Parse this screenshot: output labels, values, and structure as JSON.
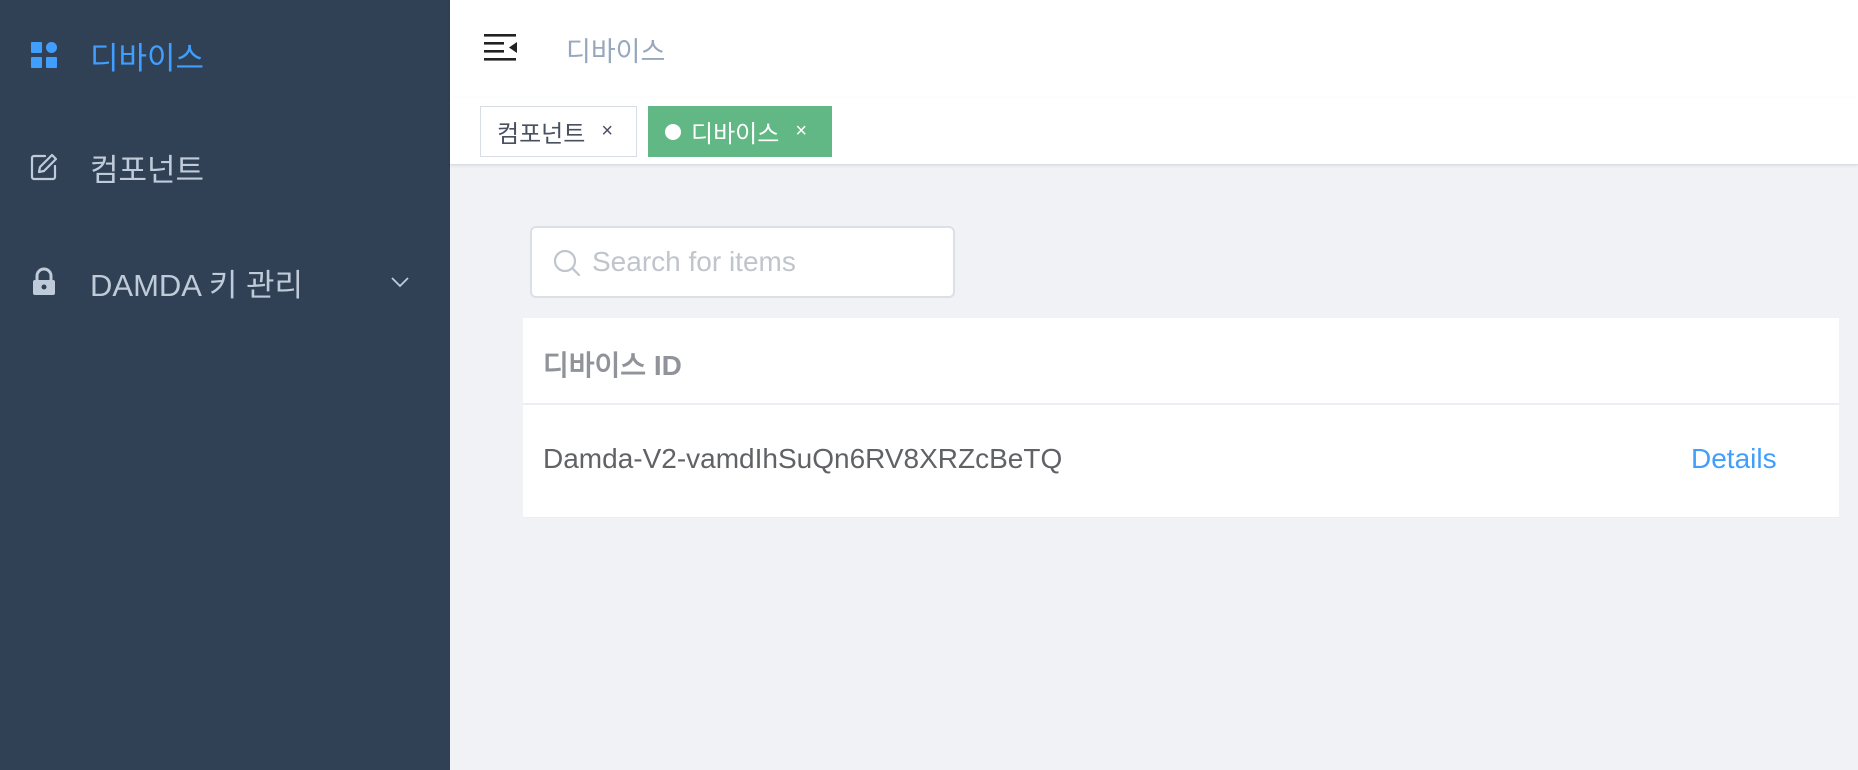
{
  "sidebar": {
    "items": [
      {
        "label": "디바이스",
        "icon": "dashboard-icon",
        "active": true
      },
      {
        "label": "컴포넌트",
        "icon": "edit-icon",
        "active": false
      },
      {
        "label": "DAMDA 키 관리",
        "icon": "lock-icon",
        "active": false,
        "expandable": true
      }
    ]
  },
  "navbar": {
    "breadcrumb": "디바이스"
  },
  "tags": [
    {
      "label": "컴포넌트",
      "close": "×",
      "active": false
    },
    {
      "label": "디바이스",
      "close": "×",
      "active": true
    }
  ],
  "search": {
    "placeholder": "Search for items",
    "value": ""
  },
  "table": {
    "columns": [
      "디바이스 ID"
    ],
    "rows": [
      {
        "device_id": "Damda-V2-vamdIhSuQn6RV8XRZcBeTQ",
        "action": "Details"
      }
    ]
  },
  "colors": {
    "sidebar_bg": "#304156",
    "sidebar_text": "#bfcbd9",
    "accent": "#409eff",
    "active_tag": "#62b884"
  }
}
